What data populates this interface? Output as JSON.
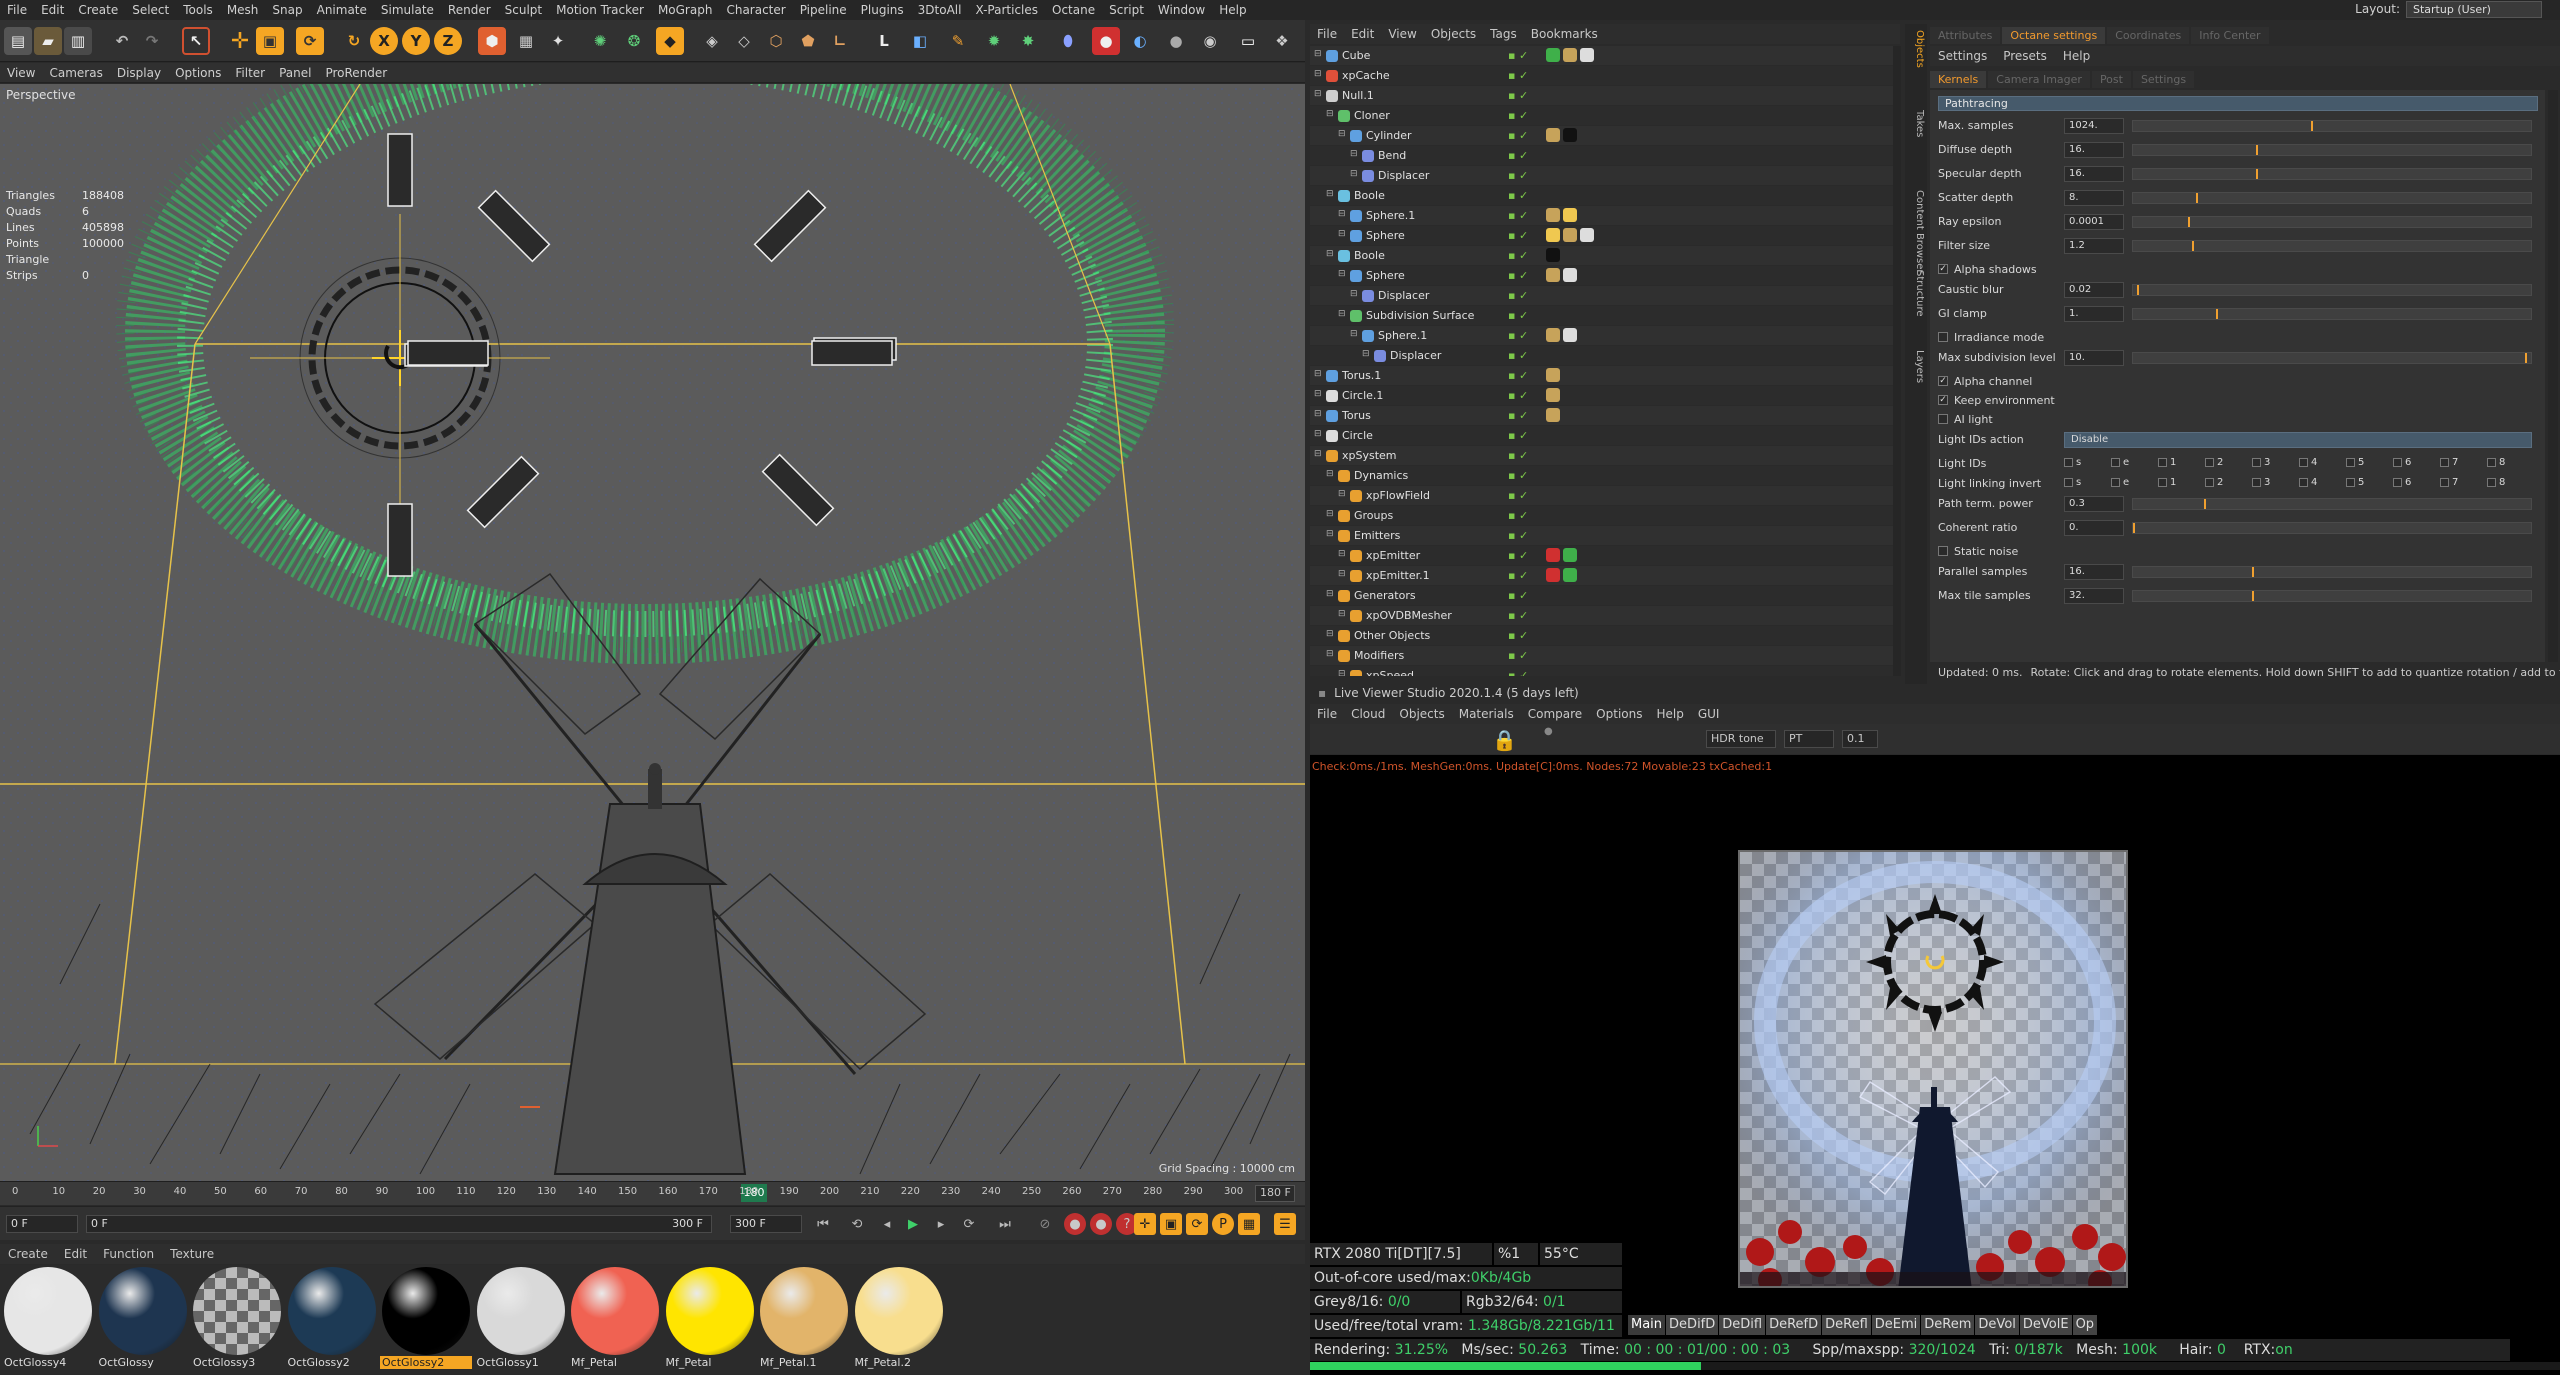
{
  "menubar": {
    "items": [
      "File",
      "Edit",
      "Create",
      "Select",
      "Tools",
      "Mesh",
      "Snap",
      "Animate",
      "Simulate",
      "Render",
      "Sculpt",
      "Motion Tracker",
      "MoGraph",
      "Character",
      "Pipeline",
      "Plugins",
      "3DtoAll",
      "X-Particles",
      "Octane",
      "Script",
      "Window",
      "Help"
    ],
    "layout_label": "Layout:",
    "layout_value": "Startup (User)"
  },
  "toolbar": {
    "axis_x": "X",
    "axis_y": "Y",
    "axis_z": "Z",
    "accent": "#f5a623"
  },
  "viewport": {
    "menu": [
      "View",
      "Cameras",
      "Display",
      "Options",
      "Filter",
      "Panel",
      "ProRender"
    ],
    "label": "Perspective",
    "stats": [
      {
        "k": "Triangles",
        "v": "188408"
      },
      {
        "k": "Quads",
        "v": "6"
      },
      {
        "k": "Lines",
        "v": "405898"
      },
      {
        "k": "Points",
        "v": "100000"
      },
      {
        "k": "Triangle Strips",
        "v": "0"
      }
    ],
    "grid_spacing": "Grid Spacing : 10000 cm"
  },
  "timeline": {
    "ticks": [
      "0",
      "10",
      "20",
      "30",
      "40",
      "50",
      "60",
      "70",
      "80",
      "90",
      "100",
      "110",
      "120",
      "130",
      "140",
      "150",
      "160",
      "170",
      "180",
      "190",
      "200",
      "210",
      "220",
      "230",
      "240",
      "250",
      "260",
      "270",
      "280",
      "290",
      "300"
    ],
    "current": "180",
    "end": "180 F"
  },
  "transport": {
    "frame": "0 F",
    "start": "0 F",
    "end1": "300 F",
    "end2": "300 F"
  },
  "materials": {
    "menu": [
      "Create",
      "Edit",
      "Function",
      "Texture"
    ],
    "items": [
      {
        "name": "OctGlossy4",
        "color": "#e6e6e6",
        "selected": false
      },
      {
        "name": "OctGlossy",
        "color": "#1e3550",
        "selected": false
      },
      {
        "name": "OctGlossy3",
        "color": "#9a9a9a",
        "selected": false
      },
      {
        "name": "OctGlossy2",
        "color": "#1d3a55",
        "selected": false
      },
      {
        "name": "OctGlossy2",
        "color": "#000000",
        "selected": true
      },
      {
        "name": "OctGlossy1",
        "color": "#d9d9d9",
        "selected": false
      },
      {
        "name": "Mf_Petal",
        "color": "#f06252",
        "selected": false
      },
      {
        "name": "Mf_Petal",
        "color": "#ffe500",
        "selected": false
      },
      {
        "name": "Mf_Petal.1",
        "color": "#e2b46a",
        "selected": false
      },
      {
        "name": "Mf_Petal.2",
        "color": "#f8de8e",
        "selected": false
      }
    ]
  },
  "object_manager": {
    "menu": [
      "File",
      "Edit",
      "View",
      "Objects",
      "Tags",
      "Bookmarks"
    ],
    "rows": [
      {
        "name": "Cube",
        "depth": 0,
        "icon": "#5fa0e0",
        "tags": [
          "#3fb04a",
          "#c7a35a",
          "#dddddd"
        ]
      },
      {
        "name": "xpCache",
        "depth": 0,
        "icon": "#e0503a",
        "tags": []
      },
      {
        "name": "Null.1",
        "depth": 0,
        "icon": "#cfcfcf",
        "tags": []
      },
      {
        "name": "Cloner",
        "depth": 1,
        "icon": "#5fc06a",
        "tags": []
      },
      {
        "name": "Cylinder",
        "depth": 2,
        "icon": "#5fa0e0",
        "tags": [
          "#c7a35a",
          "#111111"
        ]
      },
      {
        "name": "Bend",
        "depth": 3,
        "icon": "#7a8ce0",
        "tags": []
      },
      {
        "name": "Displacer",
        "depth": 3,
        "icon": "#7a8ce0",
        "tags": []
      },
      {
        "name": "Boole",
        "depth": 1,
        "icon": "#6ac0e0",
        "tags": []
      },
      {
        "name": "Sphere.1",
        "depth": 2,
        "icon": "#5fa0e0",
        "tags": [
          "#c7a35a",
          "#f0c850"
        ]
      },
      {
        "name": "Sphere",
        "depth": 2,
        "icon": "#5fa0e0",
        "tags": [
          "#f0c850",
          "#c7a35a",
          "#dddddd"
        ]
      },
      {
        "name": "Boole",
        "depth": 1,
        "icon": "#6ac0e0",
        "tags": [
          "#111111"
        ]
      },
      {
        "name": "Sphere",
        "depth": 2,
        "icon": "#5fa0e0",
        "tags": [
          "#c7a35a",
          "#dddddd"
        ]
      },
      {
        "name": "Displacer",
        "depth": 3,
        "icon": "#7a8ce0",
        "tags": []
      },
      {
        "name": "Subdivision Surface",
        "depth": 2,
        "icon": "#5fc06a",
        "tags": []
      },
      {
        "name": "Sphere.1",
        "depth": 3,
        "icon": "#5fa0e0",
        "tags": [
          "#c7a35a",
          "#dddddd"
        ]
      },
      {
        "name": "Displacer",
        "depth": 4,
        "icon": "#7a8ce0",
        "tags": []
      },
      {
        "name": "Torus.1",
        "depth": 0,
        "icon": "#5fa0e0",
        "tags": [
          "#c7a35a"
        ]
      },
      {
        "name": "Circle.1",
        "depth": 0,
        "icon": "#dddddd",
        "tags": [
          "#c7a35a"
        ]
      },
      {
        "name": "Torus",
        "depth": 0,
        "icon": "#5fa0e0",
        "tags": [
          "#c7a35a"
        ]
      },
      {
        "name": "Circle",
        "depth": 0,
        "icon": "#dddddd",
        "tags": []
      },
      {
        "name": "xpSystem",
        "depth": 0,
        "icon": "#e8a030",
        "tags": []
      },
      {
        "name": "Dynamics",
        "depth": 1,
        "icon": "#e8a030",
        "tags": []
      },
      {
        "name": "xpFlowField",
        "depth": 2,
        "icon": "#e8a030",
        "tags": []
      },
      {
        "name": "Groups",
        "depth": 1,
        "icon": "#e8a030",
        "tags": []
      },
      {
        "name": "Emitters",
        "depth": 1,
        "icon": "#e8a030",
        "tags": []
      },
      {
        "name": "xpEmitter",
        "depth": 2,
        "icon": "#e8a030",
        "tags": [
          "#d03030",
          "#3fb04a"
        ]
      },
      {
        "name": "xpEmitter.1",
        "depth": 2,
        "icon": "#e8a030",
        "tags": [
          "#d03030",
          "#3fb04a"
        ]
      },
      {
        "name": "Generators",
        "depth": 1,
        "icon": "#e8a030",
        "tags": []
      },
      {
        "name": "xpOVDBMesher",
        "depth": 2,
        "icon": "#e8a030",
        "tags": []
      },
      {
        "name": "Other Objects",
        "depth": 1,
        "icon": "#e8a030",
        "tags": []
      },
      {
        "name": "Modifiers",
        "depth": 1,
        "icon": "#e8a030",
        "tags": []
      },
      {
        "name": "xpSpeed",
        "depth": 2,
        "icon": "#e8a030",
        "tags": []
      }
    ]
  },
  "side_tabs": [
    "Objects",
    "Takes",
    "Content Browser",
    "Structure",
    "Layers"
  ],
  "attributes": {
    "tabs": [
      "Attributes",
      "Octane settings",
      "Coordinates",
      "Info Center"
    ],
    "active_tab": "Octane settings",
    "menu": [
      "Settings",
      "Presets",
      "Help"
    ],
    "sub_tabs": [
      "Kernels",
      "Camera Imager",
      "Post",
      "Settings"
    ],
    "active_sub": "Kernels",
    "kernel": "Pathtracing",
    "params": [
      {
        "type": "slider",
        "label": "Max. samples",
        "value": "1024.",
        "fill": 0.45
      },
      {
        "type": "slider",
        "label": "Diffuse depth",
        "value": "16.",
        "fill": 0.31
      },
      {
        "type": "slider",
        "label": "Specular depth",
        "value": "16.",
        "fill": 0.31
      },
      {
        "type": "slider",
        "label": "Scatter depth",
        "value": "8.",
        "fill": 0.16
      },
      {
        "type": "slider",
        "label": "Ray epsilon",
        "value": "0.0001",
        "fill": 0.14
      },
      {
        "type": "slider",
        "label": "Filter size",
        "value": "1.2",
        "fill": 0.15
      },
      {
        "type": "check",
        "label": "Alpha shadows",
        "checked": true
      },
      {
        "type": "slider",
        "label": "Caustic blur",
        "value": "0.02",
        "fill": 0.01
      },
      {
        "type": "slider",
        "label": "GI clamp",
        "value": "1.",
        "fill": 0.21
      },
      {
        "type": "check",
        "label": "Irradiance mode",
        "checked": false
      },
      {
        "type": "slider",
        "label": "Max subdivision level",
        "value": "10.",
        "fill": 0.99
      },
      {
        "type": "check",
        "label": "Alpha channel",
        "checked": true
      },
      {
        "type": "check",
        "label": "Keep environment",
        "checked": true
      },
      {
        "type": "check",
        "label": "AI light",
        "checked": false
      },
      {
        "type": "dropdown",
        "label": "Light IDs action",
        "value": "Disable"
      },
      {
        "type": "lightids",
        "label": "Light IDs",
        "cells": [
          "s",
          "e",
          "1",
          "2",
          "3",
          "4",
          "5",
          "6",
          "7",
          "8"
        ]
      },
      {
        "type": "lightids",
        "label": "Light linking invert",
        "cells": [
          "s",
          "e",
          "1",
          "2",
          "3",
          "4",
          "5",
          "6",
          "7",
          "8"
        ]
      },
      {
        "type": "slider",
        "label": "Path term. power",
        "value": "0.3",
        "fill": 0.18
      },
      {
        "type": "slider",
        "label": "Coherent ratio",
        "value": "0.",
        "fill": 0.0
      },
      {
        "type": "check",
        "label": "Static noise",
        "checked": false
      },
      {
        "type": "slider",
        "label": "Parallel samples",
        "value": "16.",
        "fill": 0.3
      },
      {
        "type": "slider",
        "label": "Max tile samples",
        "value": "32.",
        "fill": 0.3
      }
    ],
    "status": "Updated: 0 ms.",
    "status_hint": "Rotate: Click and drag to rotate elements. Hold down SHIFT to add to quantize rotation / add to t"
  },
  "live_viewer": {
    "title": "Live Viewer Studio 2020.1.4 (5 days left)",
    "menu": [
      "File",
      "Cloud",
      "Objects",
      "Materials",
      "Compare",
      "Options",
      "Help",
      "GUI"
    ],
    "tone": "HDR tone",
    "mode": "PT",
    "value": "0.1",
    "check_line": "Check:0ms./1ms. MeshGen:0ms. Update[C]:0ms. Nodes:72 Movable:23 txCached:1",
    "gpu": "RTX 2080 Ti[DT][7.5]",
    "gpu_pct": "%1",
    "gpu_temp": "55°C",
    "outofcore_label": "Out-of-core used/max:",
    "outofcore_val": "0Kb/4Gb",
    "grey_label": "Grey8/16:",
    "grey_val": "0/0",
    "rgb_label": "Rgb32/64:",
    "rgb_val": "0/1",
    "vram_label": "Used/free/total vram:",
    "vram_val": "1.348Gb/8.221Gb/11",
    "channels": [
      "Main",
      "DeDifD",
      "DeDifl",
      "DeRefD",
      "DeRefl",
      "DeEmi",
      "DeRem",
      "DeVol",
      "DeVolE",
      "Op"
    ],
    "rendering_label": "Rendering:",
    "rendering_val": "31.25%",
    "mssec_label": "Ms/sec:",
    "mssec_val": "50.263",
    "time_label": "Time:",
    "time_val": "00 : 00 : 01/00 : 00 : 03",
    "spp_label": "Spp/maxspp:",
    "spp_val": "320/1024",
    "tri_label": "Tri:",
    "tri_val": "0/187k",
    "mesh_label": "Mesh:",
    "mesh_val": "100k",
    "hair_label": "Hair:",
    "hair_val": "0",
    "rtx_label": "RTX:",
    "rtx_val": "on",
    "progress": 0.3125
  }
}
